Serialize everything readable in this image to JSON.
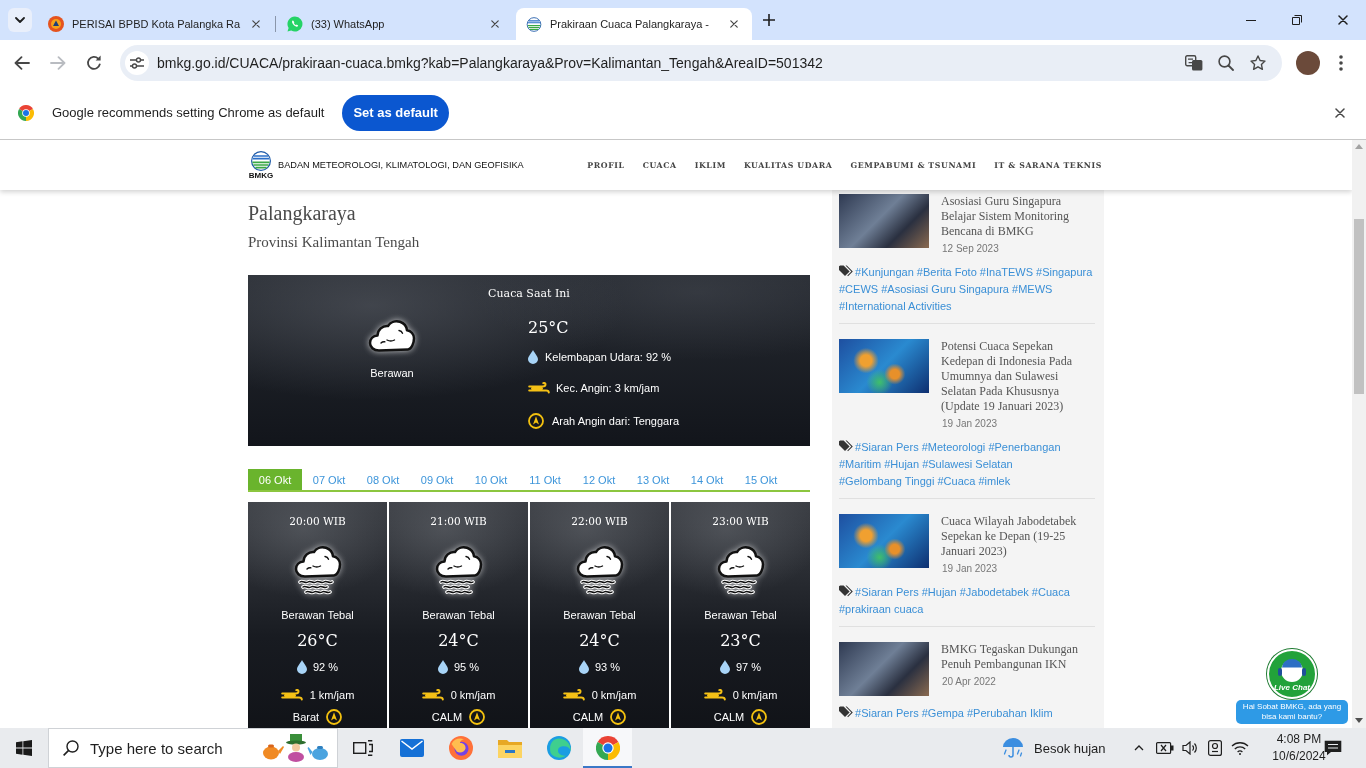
{
  "browser": {
    "tabs": [
      {
        "title": "PERISAI BPBD Kota Palangka Ra",
        "kind": "bpbd",
        "selected": false
      },
      {
        "title": "(33) WhatsApp",
        "kind": "whatsapp",
        "selected": false
      },
      {
        "title": "Prakiraan Cuaca Palangkaraya -",
        "kind": "bmkg",
        "selected": true
      }
    ],
    "nav_buttons": [
      {
        "kind": "back",
        "disabled": false
      },
      {
        "kind": "forward",
        "disabled": true
      },
      {
        "kind": "reload",
        "disabled": false
      }
    ],
    "url": "bmkg.go.id/CUACA/prakiraan-cuaca.bmkg?kab=Palangkaraya&Prov=Kalimantan_Tengah&AreaID=501342",
    "infobar": {
      "message": "Google recommends setting Chrome as default",
      "button": "Set as default"
    }
  },
  "site": {
    "header": {
      "logo_text": "BMKG",
      "org_name": "BADAN METEOROLOGI, KLIMATOLOGI, DAN GEOFISIKA",
      "menu": [
        "PROFIL",
        "CUACA",
        "IKLIM",
        "KUALITAS UDARA",
        "GEMPABUMI & TSUNAMI",
        "IT & SARANA TEKNIS"
      ]
    },
    "city": "Palangkaraya",
    "province": "Provinsi Kalimantan Tengah",
    "current": {
      "title": "Cuaca Saat Ini",
      "condition": "Berawan",
      "temperature": "25°C",
      "humidity": "Kelembapan Udara: 92 %",
      "wind_speed": "Kec. Angin: 3 km/jam",
      "wind_direction": "Arah Angin dari: Tenggara"
    },
    "date_tabs": [
      {
        "label": "06 Okt",
        "selected": true
      },
      {
        "label": "07 Okt",
        "selected": false
      },
      {
        "label": "08 Okt",
        "selected": false
      },
      {
        "label": "09 Okt",
        "selected": false
      },
      {
        "label": "10 Okt",
        "selected": false
      },
      {
        "label": "11 Okt",
        "selected": false
      },
      {
        "label": "12 Okt",
        "selected": false
      },
      {
        "label": "13 Okt",
        "selected": false
      },
      {
        "label": "14 Okt",
        "selected": false
      },
      {
        "label": "15 Okt",
        "selected": false
      }
    ],
    "hourly": [
      {
        "time": "20:00 WIB",
        "condition": "Berawan Tebal",
        "temperature": "26°C",
        "humidity": "92 %",
        "wind_speed": "1 km/jam",
        "wind_direction": "Barat"
      },
      {
        "time": "21:00 WIB",
        "condition": "Berawan Tebal",
        "temperature": "24°C",
        "humidity": "95 %",
        "wind_speed": "0 km/jam",
        "wind_direction": "CALM"
      },
      {
        "time": "22:00 WIB",
        "condition": "Berawan Tebal",
        "temperature": "24°C",
        "humidity": "93 %",
        "wind_speed": "0 km/jam",
        "wind_direction": "CALM"
      },
      {
        "time": "23:00 WIB",
        "condition": "Berawan Tebal",
        "temperature": "23°C",
        "humidity": "97 %",
        "wind_speed": "0 km/jam",
        "wind_direction": "CALM"
      }
    ],
    "news": [
      {
        "kind": "photo",
        "title": "Asosiasi Guru Singapura Belajar Sistem Monitoring Bencana di BMKG",
        "date": "12 Sep 2023",
        "tags": [
          "#Kunjungan",
          "#Berita Foto",
          "#InaTEWS",
          "#Singapura",
          "#CEWS",
          "#Asosiasi Guru Singapura",
          "#MEWS",
          "#International Activities"
        ]
      },
      {
        "kind": "map",
        "title": "Potensi Cuaca Sepekan Kedepan di Indonesia Pada Umumnya dan Sulawesi Selatan Pada Khususnya (Update 19 Januari 2023)",
        "date": "19 Jan 2023",
        "tags": [
          "#Siaran Pers",
          "#Meteorologi",
          "#Penerbangan",
          "#Maritim",
          "#Hujan",
          "#Sulawesi Selatan",
          "#Gelombang Tinggi",
          "#Cuaca",
          "#imlek"
        ]
      },
      {
        "kind": "map",
        "title": "Cuaca Wilayah Jabodetabek Sepekan ke Depan (19-25 Januari 2023)",
        "date": "19 Jan 2023",
        "tags": [
          "#Siaran Pers",
          "#Hujan",
          "#Jabodetabek",
          "#Cuaca",
          "#prakiraan cuaca"
        ]
      },
      {
        "kind": "photo",
        "title": "BMKG Tegaskan Dukungan Penuh Pembangunan IKN",
        "date": "20 Apr 2022",
        "tags": [
          "#Siaran Pers",
          "#Gempa",
          "#Perubahan Iklim"
        ]
      }
    ],
    "live_chat": {
      "label": "Live Chat",
      "greeting": "Hai Sobat BMKG, ada yang bisa kami bantu?"
    }
  },
  "taskbar": {
    "search": {
      "placeholder": "Type here to search"
    },
    "apps": [
      {
        "kind": "task-view",
        "active": false
      },
      {
        "kind": "mail",
        "active": false
      },
      {
        "kind": "firefox",
        "active": false
      },
      {
        "kind": "explorer",
        "active": false
      },
      {
        "kind": "edge",
        "active": false
      },
      {
        "kind": "chrome",
        "active": true
      }
    ],
    "weather": "Besok hujan",
    "time": "4:08 PM",
    "date": "10/6/2024"
  }
}
